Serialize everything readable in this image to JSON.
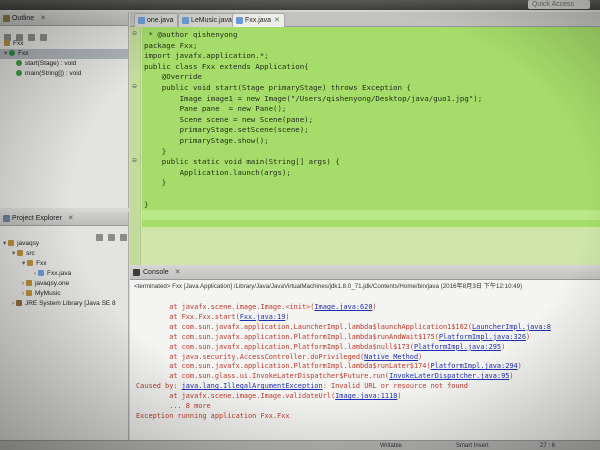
{
  "toolbar": {
    "quick_access": "Quick Access"
  },
  "outline": {
    "title": "Outline",
    "items": [
      {
        "label": "Fxx"
      },
      {
        "label": "Fxx"
      },
      {
        "label": "start(Stage) : void"
      },
      {
        "label": "main(String[]) : void"
      }
    ]
  },
  "explorer": {
    "title": "Project Explorer",
    "items": [
      {
        "label": "javaqsy"
      },
      {
        "label": "src"
      },
      {
        "label": "Fxx"
      },
      {
        "label": "Fxx.java"
      },
      {
        "label": "javaqsy.one"
      },
      {
        "label": "MyMusic"
      },
      {
        "label": "JRE System Library [Java SE 8"
      }
    ]
  },
  "editor": {
    "tabs": [
      {
        "label": "one.java"
      },
      {
        "label": "LeMusic.java"
      },
      {
        "label": "Fxx.java"
      }
    ],
    "lines": [
      " * @author qishenyong",
      "package Fxx;",
      "import javafx.application.*;",
      "public class Fxx extends Application{",
      "    @Override",
      "    public void start(Stage primaryStage) throws Exception {",
      "        Image image1 = new Image(\"/Users/qishenyong/Desktop/java/guo1.jpg\");",
      "        Pane pane  = new Pane();",
      "        Scene scene = new Scene(pane);",
      "        primaryStage.setScene(scene);",
      "        primaryStage.show();",
      "    }",
      "    public static void main(String[] args) {",
      "        Application.launch(args);",
      "    }",
      "",
      "}"
    ]
  },
  "console": {
    "title": "Console",
    "terminated": "<terminated> Fxx [Java Application] /Library/Java/JavaVirtualMachines/jdk1.8.0_71.jdk/Contents/Home/bin/java (2016年8月3日 下午12:10:49)",
    "trace": [
      {
        "text": "        at javafx.scene.image.Image.<init>(",
        "link": "Image.java:620",
        "tail": ")"
      },
      {
        "text": "        at Fxx.Fxx.start(",
        "link": "Fxx.java:19",
        "tail": ")"
      },
      {
        "text": "        at com.sun.javafx.application.LauncherImpl.lambda$launchApplication1$162(",
        "link": "LauncherImpl.java:8",
        "tail": ""
      },
      {
        "text": "        at com.sun.javafx.application.PlatformImpl.lambda$runAndWait$175(",
        "link": "PlatformImpl.java:326",
        "tail": ")"
      },
      {
        "text": "        at com.sun.javafx.application.PlatformImpl.lambda$null$173(",
        "link": "PlatformImpl.java:295",
        "tail": ")"
      },
      {
        "text": "        at java.security.AccessController.doPrivileged(",
        "link": "Native Method",
        "tail": ")"
      },
      {
        "text": "        at com.sun.javafx.application.PlatformImpl.lambda$runLater$174(",
        "link": "PlatformImpl.java:294",
        "tail": ")"
      },
      {
        "text": "        at com.sun.glass.ui.InvokeLaterDispatcher$Future.run(",
        "link": "InvokeLaterDispatcher.java:95",
        "tail": ")"
      },
      {
        "text": "Caused by: ",
        "link": "java.lang.IllegalArgumentException",
        "tail": ": Invalid URL or resource not found"
      },
      {
        "text": "        at javafx.scene.image.Image.validateUrl(",
        "link": "Image.java:1110",
        "tail": ")"
      },
      {
        "text": "        ... 8 more",
        "link": "",
        "tail": ""
      },
      {
        "text": "Exception running application Fxx.Fxx",
        "link": "",
        "tail": ""
      }
    ]
  },
  "status": {
    "writable": "Writable",
    "insert": "Smart Insert",
    "position": "27 : 6"
  },
  "colors": {
    "editor_bg": "#a6dd6a",
    "error_text": "#c0392b",
    "link": "#1f2fb5"
  }
}
